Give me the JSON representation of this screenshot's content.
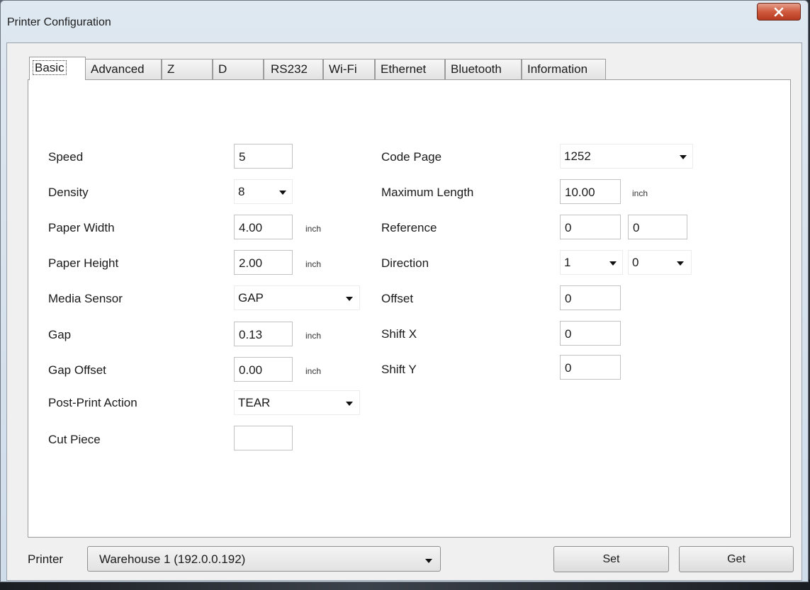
{
  "window": {
    "title": "Printer Configuration",
    "close_symbol": "x"
  },
  "tabs": [
    "Basic",
    "Advanced",
    "Z",
    "D",
    "RS232",
    "Wi-Fi",
    "Ethernet",
    "Bluetooth",
    "Information"
  ],
  "active_tab": "Basic",
  "left_fields": {
    "speed": {
      "label": "Speed",
      "value": "5"
    },
    "density": {
      "label": "Density",
      "value": "8"
    },
    "paper_width": {
      "label": "Paper Width",
      "value": "4.00",
      "unit": "inch"
    },
    "paper_height": {
      "label": "Paper Height",
      "value": "2.00",
      "unit": "inch"
    },
    "media_sensor": {
      "label": "Media Sensor",
      "value": "GAP"
    },
    "gap": {
      "label": "Gap",
      "value": "0.13",
      "unit": "inch"
    },
    "gap_offset": {
      "label": "Gap Offset",
      "value": "0.00",
      "unit": "inch"
    },
    "post_print_action": {
      "label": "Post-Print Action",
      "value": "TEAR"
    },
    "cut_piece": {
      "label": "Cut Piece",
      "value": ""
    }
  },
  "right_fields": {
    "code_page": {
      "label": "Code Page",
      "value": "1252"
    },
    "maximum_length": {
      "label": "Maximum Length",
      "value": "10.00",
      "unit": "inch"
    },
    "reference": {
      "label": "Reference",
      "x": "0",
      "y": "0"
    },
    "direction": {
      "label": "Direction",
      "value1": "1",
      "value2": "0"
    },
    "offset": {
      "label": "Offset",
      "value": "0"
    },
    "shift_x": {
      "label": "Shift X",
      "value": "0"
    },
    "shift_y": {
      "label": "Shift Y",
      "value": "0"
    }
  },
  "footer": {
    "printer_label": "Printer",
    "printer_value": "Warehouse 1 (192.0.0.192)",
    "set_label": "Set",
    "get_label": "Get"
  }
}
